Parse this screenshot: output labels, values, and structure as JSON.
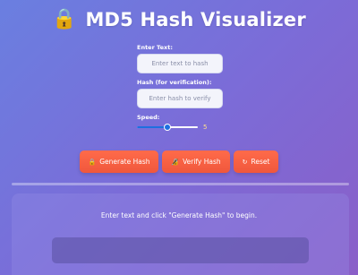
{
  "header": {
    "title": "MD5 Hash Visualizer",
    "icon": "lock-icon"
  },
  "form": {
    "text_label": "Enter Text:",
    "text_placeholder": "Enter text to hash",
    "text_value": "",
    "hash_label": "Hash (for verification):",
    "hash_placeholder": "Enter hash to verify",
    "hash_value": "",
    "speed_label": "Speed:",
    "speed_value": "5",
    "speed_fraction": 0.5
  },
  "buttons": {
    "generate_label": "Generate Hash",
    "generate_icon": "lock-icon",
    "verify_label": "Verify Hash",
    "verify_icon": "check-lock-icon",
    "reset_label": "Reset",
    "reset_icon": "refresh-icon"
  },
  "output": {
    "message": "Enter text and click \"Generate Hash\" to begin."
  },
  "colors": {
    "button": "#f0573c",
    "slider": "#1e6fe0",
    "speed_value": "#ffe08a"
  }
}
